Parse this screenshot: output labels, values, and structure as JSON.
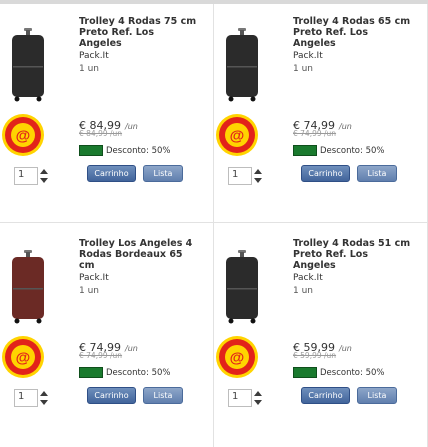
{
  "products": [
    {
      "title": "Trolley 4 Rodas 75 cm Preto Ref. Los Angeles",
      "brand": "Pack.It",
      "unit": "1 un",
      "price": "€ 84,99",
      "price_unit": "/un",
      "old_price": "€ 84,99 /un",
      "discount": "Desconto: 50%",
      "qty": "1",
      "cart_label": "Carrinho",
      "list_label": "Lista",
      "image_color": "#2b2b2b"
    },
    {
      "title": "Trolley 4 Rodas 65 cm Preto Ref. Los Angeles",
      "brand": "Pack.It",
      "unit": "1 un",
      "price": "€ 74,99",
      "price_unit": "/un",
      "old_price": "€ 74,99 /un",
      "discount": "Desconto: 50%",
      "qty": "1",
      "cart_label": "Carrinho",
      "list_label": "Lista",
      "image_color": "#2b2b2b"
    },
    {
      "title": "Trolley Los Angeles 4 Rodas Bordeaux 65 cm",
      "brand": "Pack.It",
      "unit": "1 un",
      "price": "€ 74,99",
      "price_unit": "/un",
      "old_price": "€ 74,99 /un",
      "discount": "Desconto: 50%",
      "qty": "1",
      "cart_label": "Carrinho",
      "list_label": "Lista",
      "image_color": "#6b2a25"
    },
    {
      "title": "Trolley 4 Rodas 51 cm Preto Ref. Los Angeles",
      "brand": "Pack.It",
      "unit": "1 un",
      "price": "€ 59,99",
      "price_unit": "/un",
      "old_price": "€ 59,99 /un",
      "discount": "Desconto: 50%",
      "qty": "1",
      "cart_label": "Carrinho",
      "list_label": "Lista",
      "image_color": "#2b2b2b"
    }
  ],
  "colors": {
    "badge_red": "#e2231a",
    "badge_yellow": "#ffd400",
    "button_blue": "#41649b",
    "discount_green": "#1a7a2e"
  },
  "icons": {
    "badge": "percent-badge-icon",
    "qty_arrows": "up-down-arrows-icon",
    "discount_flag": "discount-flag-icon"
  }
}
